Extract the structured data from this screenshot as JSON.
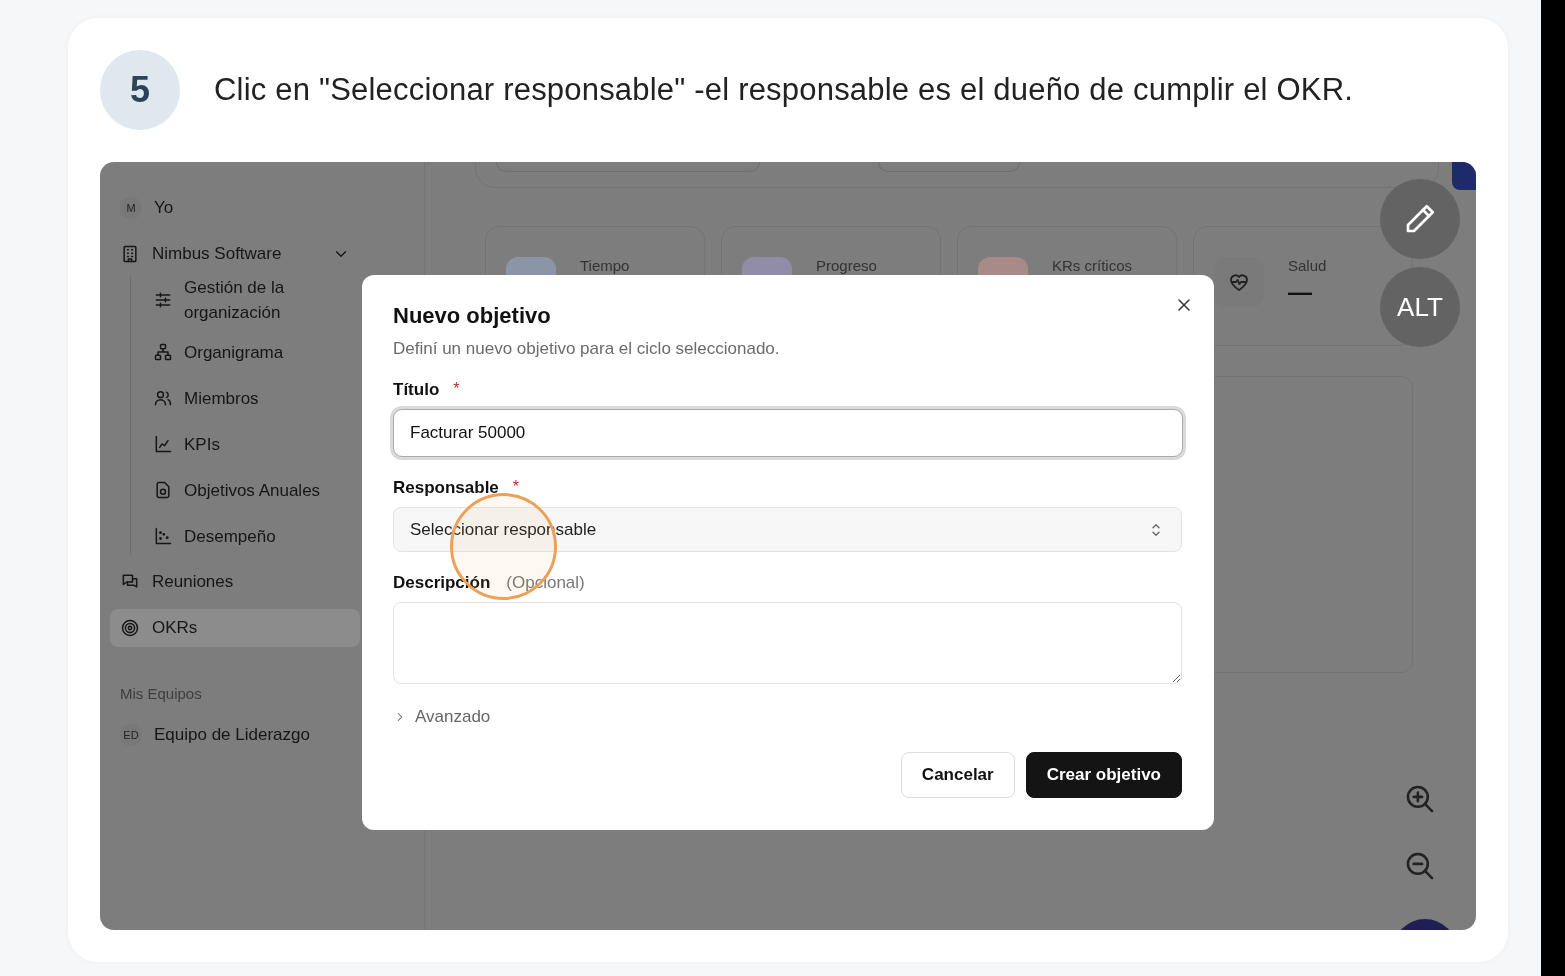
{
  "step": {
    "number": "5",
    "instruction": "Clic en \"Seleccionar responsable\" -el responsable es el dueño de cumplir el OKR."
  },
  "sidebar": {
    "items": [
      {
        "kind": "avatar",
        "avatar": "M",
        "label": "Yo",
        "selected": false
      },
      {
        "kind": "group",
        "label": "Nimbus Software",
        "expanded": true,
        "selected": false,
        "children": [
          {
            "label": "Gestión de la organización",
            "selected": false
          },
          {
            "label": "Organigrama",
            "selected": false
          },
          {
            "label": "Miembros",
            "selected": false
          },
          {
            "label": "KPIs",
            "selected": false
          },
          {
            "label": "Objetivos Anuales",
            "selected": false
          },
          {
            "label": "Desempeño",
            "selected": false
          }
        ]
      },
      {
        "kind": "link",
        "label": "Reuniones",
        "selected": false
      },
      {
        "kind": "link",
        "label": "OKRs",
        "selected": true
      }
    ],
    "section": {
      "title": "Mis Equipos",
      "items": [
        {
          "avatar": "ED",
          "label": "Equipo de Liderazgo",
          "selected": false
        }
      ]
    }
  },
  "stats": [
    {
      "label": "Tiempo",
      "color": "#8c95a8"
    },
    {
      "label": "Progreso",
      "color": "#918da8"
    },
    {
      "label": "KRs críticos",
      "color": "#a88a88"
    },
    {
      "label": "Salud",
      "value": "—",
      "color": "#7a7a7a"
    }
  ],
  "floating_buttons": [
    {
      "kind": "icon"
    },
    {
      "kind": "text",
      "label": "ALT"
    }
  ],
  "dialog": {
    "title": "Nuevo objetivo",
    "subtitle": "Definí un nuevo objetivo para el ciclo seleccionado.",
    "fields": [
      {
        "kind": "input",
        "label": "Título",
        "required_mark": "*",
        "value": "Facturar 50000",
        "focused": true
      },
      {
        "kind": "select",
        "label": "Responsable",
        "required_mark": "*",
        "placeholder": "Seleccionar responsable"
      },
      {
        "kind": "textarea",
        "label": "Descripción",
        "hint": "(Opcional)"
      }
    ],
    "advanced": {
      "label": "Avanzado",
      "expanded": false
    },
    "buttons": [
      {
        "kind": "secondary",
        "label": "Cancelar"
      },
      {
        "kind": "primary",
        "label": "Crear objetivo"
      }
    ]
  }
}
